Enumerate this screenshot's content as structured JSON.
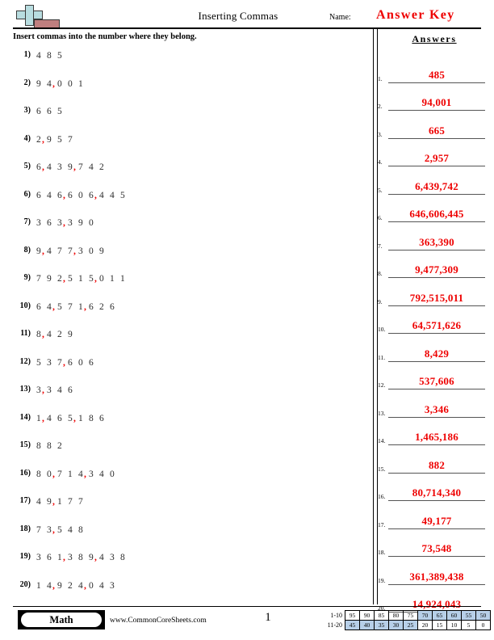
{
  "header": {
    "title": "Inserting Commas",
    "name_label": "Name:",
    "answer_key_label": "Answer Key",
    "logo_icon": "plus-block-logo",
    "colors": {
      "answer_red": "#ee0000",
      "logo_plus": "#b8dde0",
      "logo_bar": "#c07f7f",
      "grade_highlight": "#b7cfe8"
    }
  },
  "instruction": "Insert commas into the number where they belong.",
  "answers_column": {
    "heading": "Answers"
  },
  "problems": [
    {
      "num": "1)",
      "idx": "1.",
      "digits": "485",
      "commas": [],
      "answer": "485"
    },
    {
      "num": "2)",
      "idx": "2.",
      "digits": "94001",
      "commas": [
        2
      ],
      "answer": "94,001"
    },
    {
      "num": "3)",
      "idx": "3.",
      "digits": "665",
      "commas": [],
      "answer": "665"
    },
    {
      "num": "4)",
      "idx": "4.",
      "digits": "2957",
      "commas": [
        1
      ],
      "answer": "2,957"
    },
    {
      "num": "5)",
      "idx": "5.",
      "digits": "6439742",
      "commas": [
        1,
        4
      ],
      "answer": "6,439,742"
    },
    {
      "num": "6)",
      "idx": "6.",
      "digits": "646606445",
      "commas": [
        3,
        6
      ],
      "answer": "646,606,445"
    },
    {
      "num": "7)",
      "idx": "7.",
      "digits": "363390",
      "commas": [
        3
      ],
      "answer": "363,390"
    },
    {
      "num": "8)",
      "idx": "8.",
      "digits": "9477309",
      "commas": [
        1,
        4
      ],
      "answer": "9,477,309"
    },
    {
      "num": "9)",
      "idx": "9.",
      "digits": "792515011",
      "commas": [
        3,
        6
      ],
      "answer": "792,515,011"
    },
    {
      "num": "10)",
      "idx": "10.",
      "digits": "64571626",
      "commas": [
        2,
        5
      ],
      "answer": "64,571,626"
    },
    {
      "num": "11)",
      "idx": "11.",
      "digits": "8429",
      "commas": [
        1
      ],
      "answer": "8,429"
    },
    {
      "num": "12)",
      "idx": "12.",
      "digits": "537606",
      "commas": [
        3
      ],
      "answer": "537,606"
    },
    {
      "num": "13)",
      "idx": "13.",
      "digits": "3346",
      "commas": [
        1
      ],
      "answer": "3,346"
    },
    {
      "num": "14)",
      "idx": "14.",
      "digits": "1465186",
      "commas": [
        1,
        4
      ],
      "answer": "1,465,186"
    },
    {
      "num": "15)",
      "idx": "15.",
      "digits": "882",
      "commas": [],
      "answer": "882"
    },
    {
      "num": "16)",
      "idx": "16.",
      "digits": "80714340",
      "commas": [
        2,
        5
      ],
      "answer": "80,714,340"
    },
    {
      "num": "17)",
      "idx": "17.",
      "digits": "49177",
      "commas": [
        2
      ],
      "answer": "49,177"
    },
    {
      "num": "18)",
      "idx": "18.",
      "digits": "73548",
      "commas": [
        2
      ],
      "answer": "73,548"
    },
    {
      "num": "19)",
      "idx": "19.",
      "digits": "361389438",
      "commas": [
        3,
        6
      ],
      "answer": "361,389,438"
    },
    {
      "num": "20)",
      "idx": "20.",
      "digits": "14924043",
      "commas": [
        2,
        5
      ],
      "answer": "14,924,043"
    }
  ],
  "footer": {
    "subject_label": "Math",
    "website": "www.CommonCoreSheets.com",
    "page_number": "1",
    "grading_table": {
      "row1_label": "1-10",
      "row2_label": "11-20",
      "row1": [
        "95",
        "90",
        "85",
        "80",
        "75",
        "70",
        "65",
        "60",
        "55",
        "50"
      ],
      "row2": [
        "45",
        "40",
        "35",
        "30",
        "25",
        "20",
        "15",
        "10",
        "5",
        "0"
      ],
      "row1_highlight": [
        false,
        false,
        false,
        false,
        false,
        true,
        true,
        true,
        true,
        true
      ],
      "row2_highlight": [
        true,
        true,
        true,
        true,
        true,
        false,
        false,
        false,
        false,
        false
      ]
    }
  }
}
